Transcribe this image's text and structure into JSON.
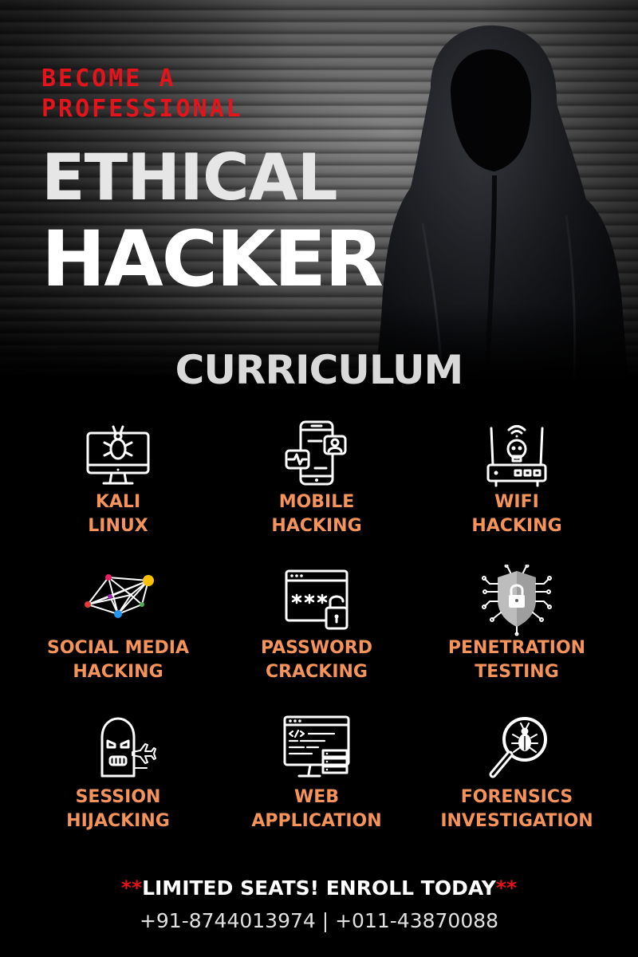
{
  "hero": {
    "kicker_line1": "BECOME A",
    "kicker_line2": "PROFESSIONAL",
    "title_line1": "ETHICAL",
    "title_line2": "HACKER"
  },
  "section_title": "CURRICULUM",
  "modules": [
    {
      "line1": "KALI",
      "line2": "LINUX",
      "icon": "bug-monitor-icon"
    },
    {
      "line1": "MOBILE",
      "line2": "HACKING",
      "icon": "mobile-hacking-icon"
    },
    {
      "line1": "WIFI",
      "line2": "HACKING",
      "icon": "wifi-router-skull-icon"
    },
    {
      "line1": "SOCIAL MEDIA",
      "line2": "HACKING",
      "icon": "network-graph-icon"
    },
    {
      "line1": "PASSWORD",
      "line2": "CRACKING",
      "icon": "password-lock-icon"
    },
    {
      "line1": "PENETRATION",
      "line2": "TESTING",
      "icon": "shield-lock-icon"
    },
    {
      "line1": "SESSION",
      "line2": "HIJACKING",
      "icon": "masked-hijacker-icon"
    },
    {
      "line1": "WEB",
      "line2": "APPLICATION",
      "icon": "web-code-icon"
    },
    {
      "line1": "FORENSICS",
      "line2": "INVESTIGATION",
      "icon": "magnifier-bug-icon"
    }
  ],
  "footer": {
    "stars_left": "**",
    "cta": "LIMITED SEATS! ENROLL TODAY",
    "stars_right": "**",
    "phones": "+91-8744013974 | +011-43870088"
  },
  "colors": {
    "accent_red": "#e3141b",
    "module_label_orange": "#f5935a",
    "background": "#000000"
  }
}
